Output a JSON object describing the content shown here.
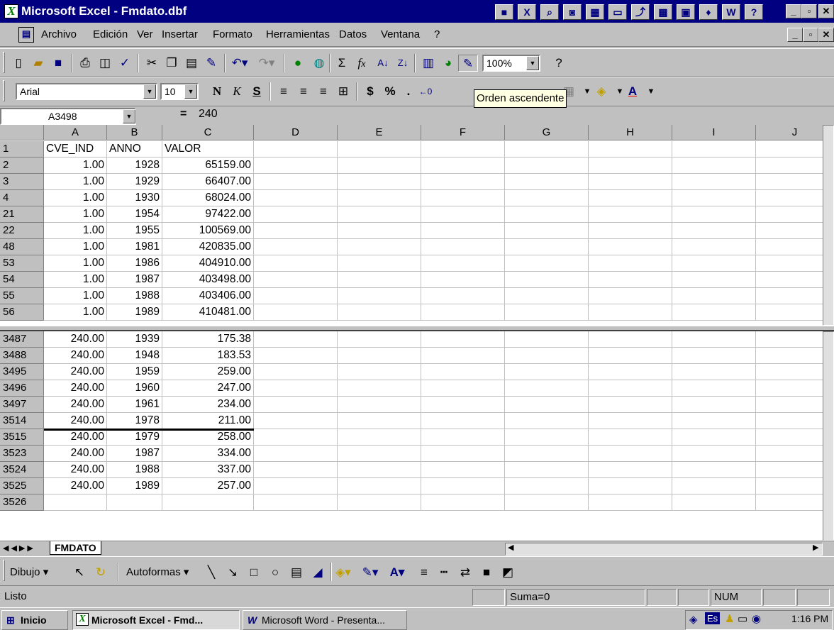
{
  "window": {
    "title": "Microsoft Excel - Fmdato.dbf",
    "title_icon": "excel-icon"
  },
  "menu": [
    "Archivo",
    "Edición",
    "Ver",
    "Insertar",
    "Formato",
    "Herramientas",
    "Datos",
    "Ventana",
    "?"
  ],
  "format_toolbar": {
    "font_name": "Arial",
    "font_size": "10",
    "bold_label": "N",
    "italic_label": "K",
    "underline_label": "S"
  },
  "standard_toolbar": {
    "zoom": "100%"
  },
  "tooltip": "Orden ascendente",
  "formula_bar": {
    "cell_ref": "A3498",
    "equals": "=",
    "value": "240"
  },
  "columns": [
    "A",
    "B",
    "C",
    "D",
    "E",
    "F",
    "G",
    "H",
    "I",
    "J"
  ],
  "rows_top": [
    {
      "row": "1",
      "a": "CVE_IND",
      "b": "ANNO",
      "c": "VALOR"
    },
    {
      "row": "2",
      "a": "1.00",
      "b": "1928",
      "c": "65159.00"
    },
    {
      "row": "3",
      "a": "1.00",
      "b": "1929",
      "c": "66407.00"
    },
    {
      "row": "4",
      "a": "1.00",
      "b": "1930",
      "c": "68024.00"
    },
    {
      "row": "21",
      "a": "1.00",
      "b": "1954",
      "c": "97422.00"
    },
    {
      "row": "22",
      "a": "1.00",
      "b": "1955",
      "c": "100569.00"
    },
    {
      "row": "48",
      "a": "1.00",
      "b": "1981",
      "c": "420835.00"
    },
    {
      "row": "53",
      "a": "1.00",
      "b": "1986",
      "c": "404910.00"
    },
    {
      "row": "54",
      "a": "1.00",
      "b": "1987",
      "c": "403498.00"
    },
    {
      "row": "55",
      "a": "1.00",
      "b": "1988",
      "c": "403406.00"
    },
    {
      "row": "56",
      "a": "1.00",
      "b": "1989",
      "c": "410481.00"
    }
  ],
  "rows_bottom": [
    {
      "row": "3487",
      "a": "240.00",
      "b": "1939",
      "c": "175.38"
    },
    {
      "row": "3488",
      "a": "240.00",
      "b": "1948",
      "c": "183.53"
    },
    {
      "row": "3495",
      "a": "240.00",
      "b": "1959",
      "c": "259.00"
    },
    {
      "row": "3496",
      "a": "240.00",
      "b": "1960",
      "c": "247.00"
    },
    {
      "row": "3497",
      "a": "240.00",
      "b": "1961",
      "c": "234.00"
    },
    {
      "row": "3514",
      "a": "240.00",
      "b": "1978",
      "c": "211.00"
    },
    {
      "row": "3515",
      "a": "240.00",
      "b": "1979",
      "c": "258.00"
    },
    {
      "row": "3523",
      "a": "240.00",
      "b": "1987",
      "c": "334.00"
    },
    {
      "row": "3524",
      "a": "240.00",
      "b": "1988",
      "c": "337.00"
    },
    {
      "row": "3525",
      "a": "240.00",
      "b": "1989",
      "c": "257.00"
    },
    {
      "row": "3526",
      "a": "",
      "b": "",
      "c": ""
    }
  ],
  "sheet_tab": "FMDATO",
  "drawing_toolbar": {
    "draw_label": "Dibujo",
    "autoshapes_label": "Autoformas"
  },
  "status": {
    "ready": "Listo",
    "sum": "Suma=0",
    "num": "NUM"
  },
  "taskbar": {
    "start": "Inicio",
    "task1": "Microsoft Excel - Fmd...",
    "task2": "Microsoft Word - Presenta...",
    "lang": "Es",
    "clock": "1:16 PM"
  }
}
